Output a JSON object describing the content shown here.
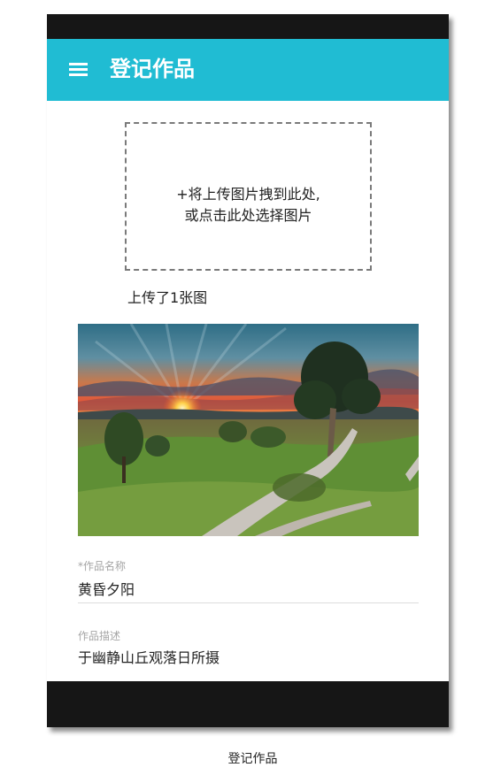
{
  "app_bar": {
    "title": "登记作品",
    "menu_icon": "menu-icon"
  },
  "upload": {
    "drop_line1": "+将上传图片拽到此处,",
    "drop_line2": "或点击此处选择图片",
    "count_text": "上传了1张图"
  },
  "form": {
    "name": {
      "label": "*作品名称",
      "value": "黄昏夕阳"
    },
    "description": {
      "label": "作品描述",
      "value": "于幽静山丘观落日所摄"
    }
  },
  "caption": "登记作品",
  "colors": {
    "accent": "#20bcd3",
    "system_bars": "#161616",
    "label": "#a5a5a5"
  }
}
